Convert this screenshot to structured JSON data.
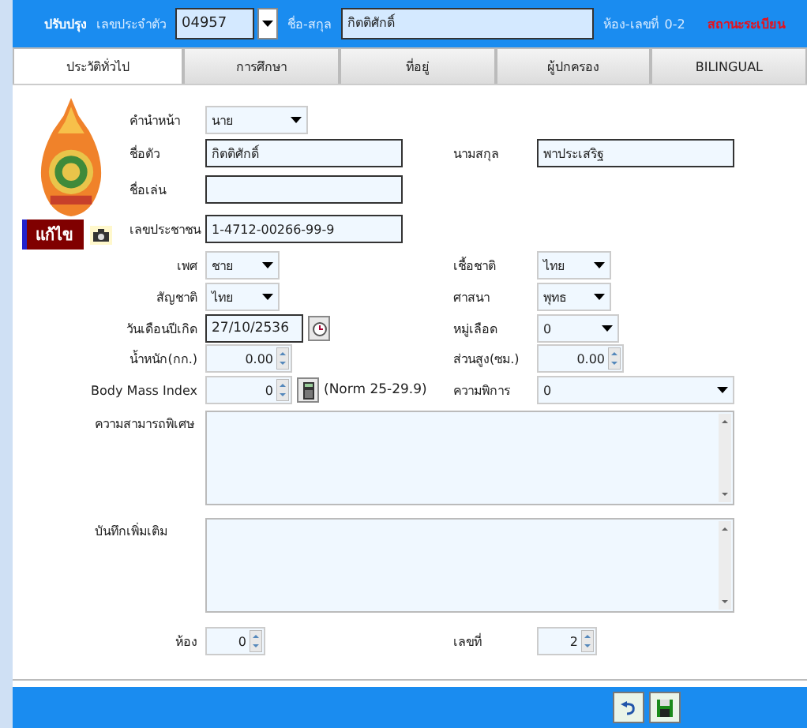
{
  "header": {
    "mode": "ปรับปรุง",
    "id_label": "เลขประจำตัว",
    "id_value": "04957",
    "name_label": "ชื่อ-สกุล",
    "name_value": "กิตติศักดิ์",
    "room_label": "ห้อง-เลขที่",
    "room_value": "0-2",
    "status": "สถานะระเบียน"
  },
  "tabs": [
    {
      "label": "ประวัติทั่วไป",
      "selected": true
    },
    {
      "label": "การศึกษา",
      "selected": false
    },
    {
      "label": "ที่อยู่",
      "selected": false
    },
    {
      "label": "ผู้ปกครอง",
      "selected": false
    },
    {
      "label": "BILINGUAL",
      "selected": false
    }
  ],
  "photo": {
    "badge": "แก้ไข"
  },
  "identity": [
    {
      "left": {
        "label": "คำนำหน้า",
        "kind": "dropdown",
        "value": "นาย"
      }
    },
    {
      "left": {
        "label": "ชื่อตัว",
        "kind": "text",
        "value": "กิตติศักดิ์"
      },
      "right": {
        "label": "นามสกุล",
        "kind": "text",
        "value": "พาประเสริฐ"
      }
    },
    {
      "left": {
        "label": "ชื่อเล่น",
        "kind": "text"
      }
    },
    {
      "left": {
        "label": "เลขประชาชน",
        "kind": "text",
        "value": "1-4712-00266-99-9"
      }
    }
  ],
  "details": [
    {
      "left": {
        "label": "เพศ",
        "kind": "dropdown",
        "value": "ชาย"
      },
      "right": {
        "label": "เชื้อชาติ",
        "kind": "dropdown",
        "value": "ไทย"
      }
    },
    {
      "left": {
        "label": "สัญชาติ",
        "kind": "dropdown",
        "value": "ไทย"
      },
      "right": {
        "label": "ศาสนา",
        "kind": "dropdown",
        "value": "พุทธ"
      }
    },
    {
      "left": {
        "label": "วันเดือนปีเกิด",
        "kind": "date",
        "value": "27/10/2536"
      },
      "right": {
        "label": "หมู่เลือด",
        "kind": "combo",
        "value": "0"
      }
    },
    {
      "left": {
        "label": "น้ำหนัก(กก.)",
        "kind": "spin",
        "value": "0.00"
      },
      "right": {
        "label": "ส่วนสูง(ซม.)",
        "kind": "spin",
        "value": "0.00"
      }
    },
    {
      "left": {
        "label": "Body Mass Index",
        "kind": "bmi",
        "value": "0",
        "note": "(Norm 25-29.9)"
      },
      "right": {
        "label": "ความพิการ",
        "kind": "widecombo",
        "value": "0"
      }
    }
  ],
  "notes": [
    {
      "label": "ความสามารถพิเศษ"
    },
    {
      "label": "บันทึกเพิ่มเติม"
    }
  ],
  "footer_fields": [
    {
      "label": "ห้อง",
      "value": "0"
    },
    {
      "label": "เลขที่",
      "value": "2"
    }
  ]
}
